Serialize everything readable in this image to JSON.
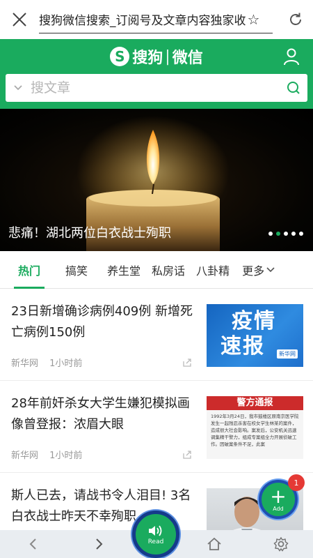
{
  "browser": {
    "url_text": "搜狗微信搜索_订阅号及文章内容独家收",
    "star": "☆"
  },
  "header": {
    "logo_mark": "S",
    "logo_text_1": "搜狗",
    "logo_sep": "|",
    "logo_text_2": "微信",
    "search_placeholder": "搜文章"
  },
  "banner": {
    "caption": "悲痛！湖北两位白衣战士殉职",
    "dots": 5,
    "active_dot": 1
  },
  "tabs": [
    {
      "label": "热门"
    },
    {
      "label": "搞笑"
    },
    {
      "label": "养生堂"
    },
    {
      "label": "私房话"
    },
    {
      "label": "八卦精"
    },
    {
      "label": "更多"
    }
  ],
  "articles": [
    {
      "title": "23日新增确诊病例409例 新增死亡病例150例",
      "source": "新华网",
      "time": "1小时前",
      "thumb": {
        "line1": "疫情",
        "line2": "速报",
        "tag": "新华网"
      }
    },
    {
      "title": "28年前奸杀女大学生嫌犯模拟画像曾登报：浓眉大眼",
      "source": "新华网",
      "time": "1小时前",
      "thumb": {
        "header": "警方通报",
        "body": "1992年3月24日，我市鼓楼区原南京医学院发生一起残忍杀害在校女学生林某的案件，造成很大社会影响。案发后，公安机关迅速调集精干警力，组成专案组全力开展侦破工作。因破案条件不足，此案"
      }
    },
    {
      "title": "斯人已去，请战书令人泪目! 3名白衣战士昨天不幸殉职",
      "source": "",
      "time": ""
    }
  ],
  "fab_add": {
    "label": "Add",
    "badge": "1"
  },
  "fab_read": {
    "label": "Read"
  },
  "colors": {
    "brand_green": "#1aab5e",
    "fab_ring": "#1e4fb0",
    "badge_red": "#e53935"
  }
}
